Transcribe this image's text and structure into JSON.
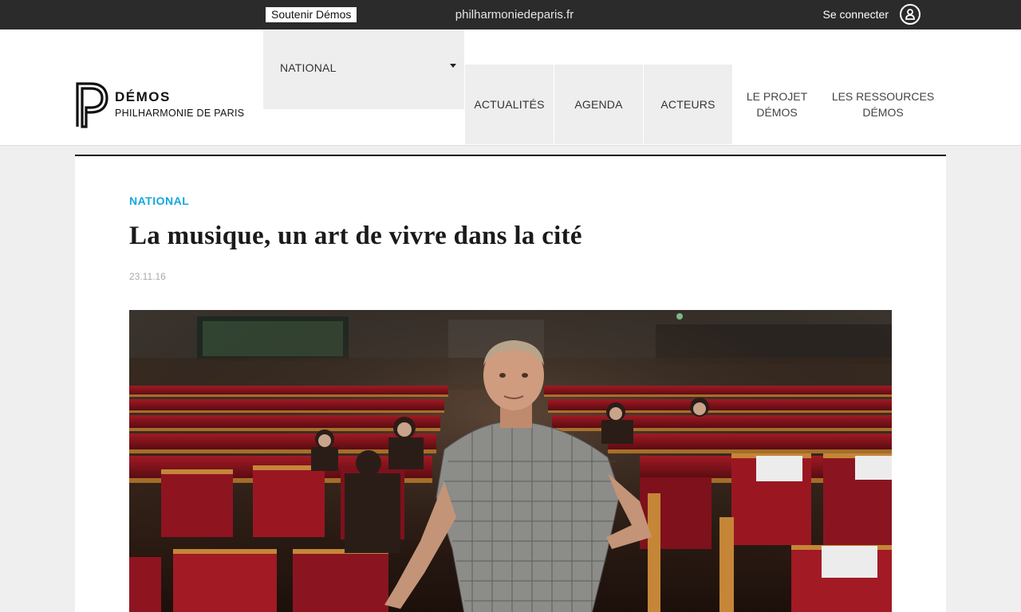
{
  "topbar": {
    "support_label": "Soutenir Démos",
    "site_link": "philharmoniedeparis.fr",
    "login_label": "Se connecter",
    "login_icon": "user-icon"
  },
  "logo": {
    "name": "DÉMOS",
    "subtitle": "PHILHARMONIE DE PARIS"
  },
  "nav": {
    "dropdown_label": "NATIONAL",
    "items": [
      {
        "label": "ACTUALITÉS"
      },
      {
        "label": "AGENDA"
      },
      {
        "label": "ACTEURS"
      },
      {
        "label": "LE PROJET DÉMOS"
      },
      {
        "label": "LES RESSOURCES DÉMOS"
      }
    ]
  },
  "article": {
    "category": "NATIONAL",
    "title": "La musique, un art de vivre dans la cité",
    "date": "23.11.16"
  },
  "colors": {
    "topbar_bg": "#2b2b2b",
    "accent_blue": "#15a6e0",
    "nav_bg": "#eeeeee"
  }
}
